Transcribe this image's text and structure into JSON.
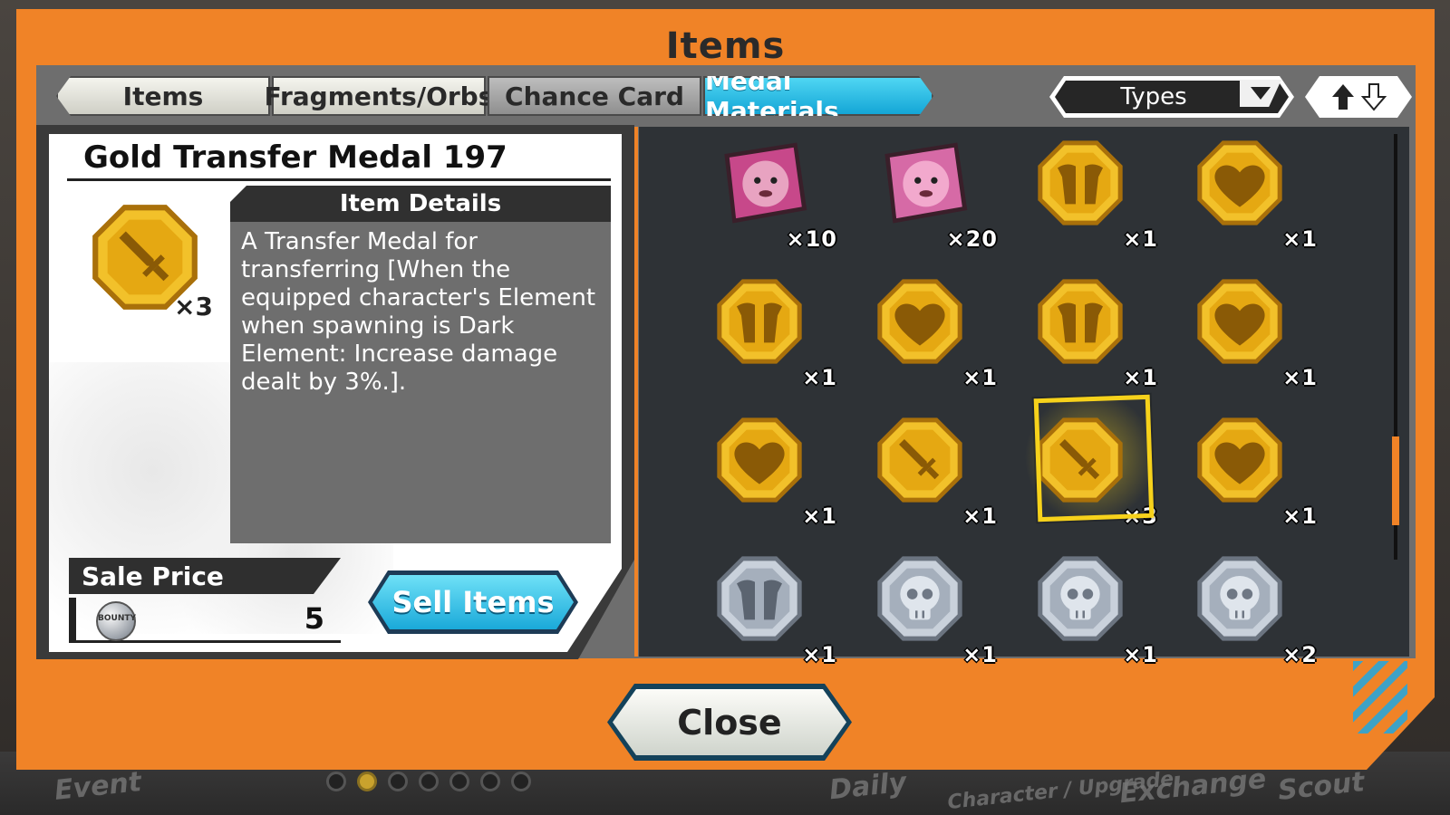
{
  "window": {
    "title": "Items"
  },
  "tabs": [
    {
      "label": "Items"
    },
    {
      "label": "Fragments/Orbs"
    },
    {
      "label": "Chance Card"
    },
    {
      "label": "Medal Materials",
      "active": true
    }
  ],
  "filter": {
    "types_label": "Types",
    "sort_icon": "sort-up-down-icon"
  },
  "detail": {
    "name": "Gold Transfer Medal 197",
    "icon": "sword-medal-icon",
    "count": "×3",
    "details_header": "Item Details",
    "description": "A Transfer Medal for transferring [When the equipped character's Element when spawning is Dark Element: Increase damage dealt by 3%.].",
    "sale_price_label": "Sale Price",
    "sale_coin_label": "BOUNTY",
    "sale_price_value": "5",
    "sell_button": "Sell Items"
  },
  "grid": [
    {
      "type": "chopper-fragment-icon",
      "count": "×10"
    },
    {
      "type": "pink-character-fragment-icon",
      "count": "×20"
    },
    {
      "type": "gold-armor-medal-icon",
      "count": "×1"
    },
    {
      "type": "gold-heart-medal-icon",
      "count": "×1"
    },
    {
      "type": "gold-armor-medal-icon",
      "count": "×1"
    },
    {
      "type": "gold-heart-medal-icon",
      "count": "×1"
    },
    {
      "type": "gold-armor-medal-icon",
      "count": "×1"
    },
    {
      "type": "gold-heart-medal-icon",
      "count": "×1"
    },
    {
      "type": "gold-heart-medal-icon",
      "count": "×1"
    },
    {
      "type": "gold-sword-medal-icon",
      "count": "×1"
    },
    {
      "type": "gold-sword-medal-icon",
      "count": "×3",
      "selected": true
    },
    {
      "type": "gold-heart-medal-icon",
      "count": "×1"
    },
    {
      "type": "silver-armor-medal-icon",
      "count": "×1"
    },
    {
      "type": "silver-skull-medal-icon",
      "count": "×1"
    },
    {
      "type": "silver-skull-medal-icon",
      "count": "×1"
    },
    {
      "type": "silver-skull-medal-icon",
      "count": "×2"
    }
  ],
  "close_button": "Close",
  "background_tabs": [
    "Event",
    "Daily",
    "Character / Upgrade",
    "Exchange",
    "Scout"
  ],
  "colors": {
    "frame": "#f08327",
    "accent": "#1aa9d9",
    "gold": "#e0a815",
    "silver": "#aab4c0"
  }
}
